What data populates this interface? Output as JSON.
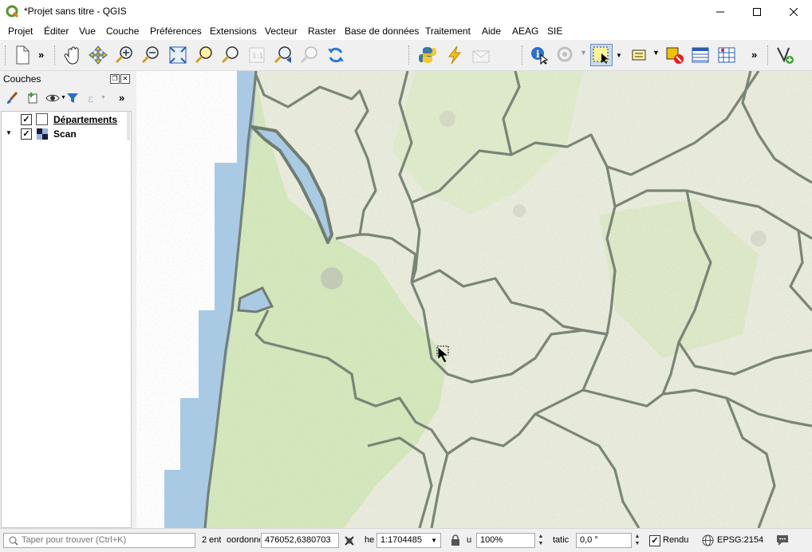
{
  "window": {
    "title": "*Projet sans titre - QGIS"
  },
  "menu": [
    "Projet",
    "Éditer",
    "Vue",
    "Couche",
    "Préférences",
    "Extensions",
    "Vecteur",
    "Raster",
    "Base de données",
    "Traitement",
    "Aide",
    "AEAG",
    "SIE"
  ],
  "toolbar": {
    "more_label": "»"
  },
  "layers_panel": {
    "title": "Couches",
    "more_label": "»",
    "layers": [
      {
        "name": "Départements",
        "checked": true,
        "checkmark": "✓"
      },
      {
        "name": "Scan",
        "checked": true,
        "checkmark": "✓"
      }
    ]
  },
  "status": {
    "search_placeholder": "Taper pour trouver (Ctrl+K)",
    "entities_label": "2 ent",
    "coord_label": "oordonné",
    "coord_value": "476052,6380703",
    "scale_label": "he",
    "scale_value": "1:1704485",
    "magnifier_label": "u",
    "magnifier_value": "100%",
    "rotation_label": "tatic",
    "rotation_value": "0,0 °",
    "render_label": "Rendu",
    "render_checked": true,
    "render_checkmark": "✓",
    "crs": "EPSG:2154"
  },
  "colors": {
    "sea": "#a9cbe6",
    "land_green": "#d5e8bc",
    "land_light": "#e9ecdc",
    "boundary": "#6e7a6e",
    "selection": "#c8dcf0"
  }
}
